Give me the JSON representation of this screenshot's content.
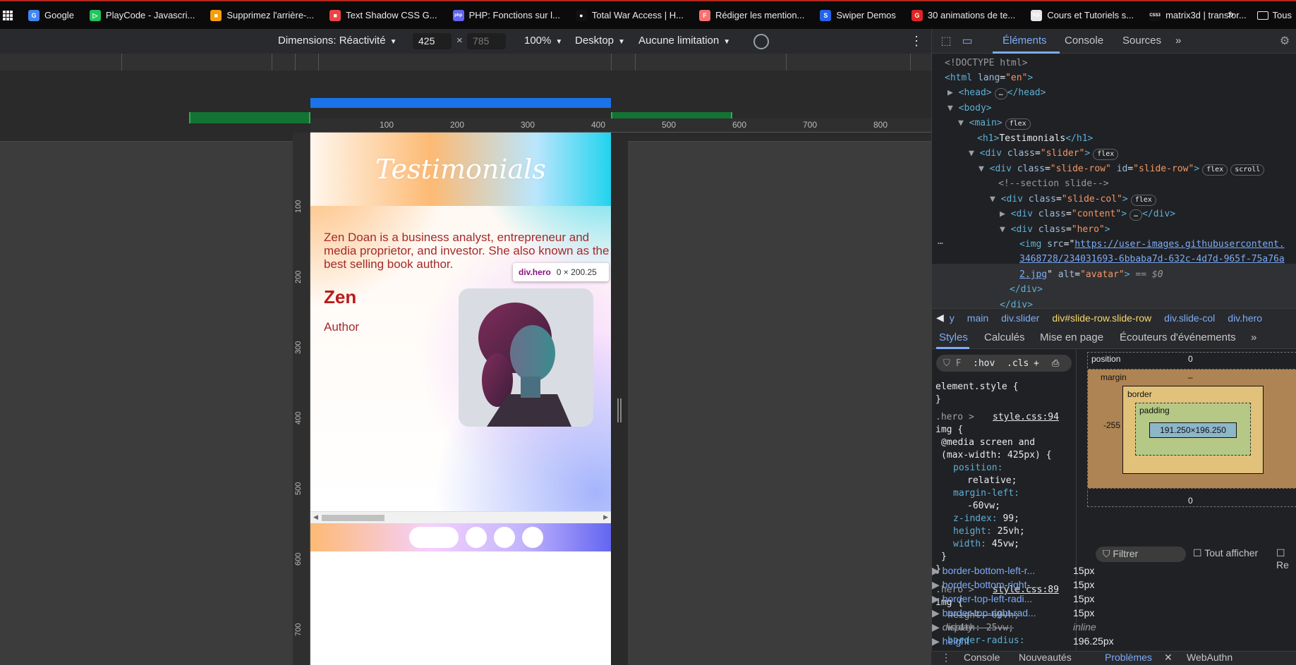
{
  "bookmarks": [
    {
      "label": "Google",
      "color": "#4285f4",
      "glyph": "G"
    },
    {
      "label": "PlayCode - Javascri...",
      "color": "#22c55e",
      "glyph": "▷"
    },
    {
      "label": "Supprimez l'arrière-...",
      "color": "#f59e0b",
      "glyph": "■"
    },
    {
      "label": "Text Shadow CSS G...",
      "color": "#ef4444",
      "glyph": "■"
    },
    {
      "label": "PHP: Fonctions sur l...",
      "color": "#6366f1",
      "glyph": "php"
    },
    {
      "label": "Total War Access | H...",
      "color": "#111111",
      "glyph": "●"
    },
    {
      "label": "Rédiger les mention...",
      "color": "#f87171",
      "glyph": "F"
    },
    {
      "label": "Swiper Demos",
      "color": "#2563eb",
      "glyph": "S"
    },
    {
      "label": "30 animations de te...",
      "color": "#dc2626",
      "glyph": "G"
    },
    {
      "label": "Cours et Tutoriels s...",
      "color": "#e5e7eb",
      "glyph": "SQL"
    },
    {
      "label": "matrix3d | transfor...",
      "color": "#111111",
      "glyph": "CSS3"
    }
  ],
  "bookmarks_more": "»",
  "other_bookmarks": "Tous",
  "device_toolbar": {
    "dimensions_label": "Dimensions: Réactivité",
    "width": "425",
    "height": "785",
    "zoom": "100%",
    "device_type": "Desktop",
    "throttle": "Aucune limitation"
  },
  "ruler_top": [
    "100",
    "200",
    "300",
    "400",
    "500",
    "600",
    "700",
    "800"
  ],
  "ruler_left": [
    "100",
    "200",
    "300",
    "400",
    "500",
    "600",
    "700"
  ],
  "page": {
    "title": "Testimonials",
    "bio": "Zen Doan is a business analyst, entrepreneur and media proprietor, and investor. She also known as the best selling book author.",
    "name": "Zen",
    "role": "Author"
  },
  "tooltip": {
    "selector": "div.hero",
    "size": "0 × 200.25"
  },
  "devtools": {
    "tabs": [
      "Éléments",
      "Console",
      "Sources"
    ],
    "more": "»",
    "tree": {
      "doctype": "<!DOCTYPE html>",
      "html_tag": "html",
      "lang_attr": "lang",
      "lang_val": "\"en\"",
      "head": "head",
      "body": "body",
      "main": "main",
      "h1_text": "Testimonials",
      "slider_class": "\"slider\"",
      "slide_row_class": "\"slide-row\"",
      "slide_row_id": "\"slide-row\"",
      "comment": "<!--section slide-->",
      "slide_col_class": "\"slide-col\"",
      "content_class": "\"content\"",
      "hero_class": "\"hero\"",
      "img_src_1": "https://user-images.githubusercontent.",
      "img_src_2": "3468728/234031693-6bbaba7d-632c-4d7d-965f-75a76a",
      "img_src_3": "2.jpg",
      "img_alt": "\"avatar\"",
      "dollar": "== $0",
      "pill_flex": "flex",
      "pill_scroll": "scroll"
    },
    "crumbs": [
      "y",
      "main",
      "div.slider",
      "div#slide-row.slide-row",
      "div.slide-col",
      "div.hero"
    ],
    "subtabs": [
      "Styles",
      "Calculés",
      "Mise en page",
      "Écouteurs d'événements"
    ],
    "filter_placeholder": "F",
    "hov": ":hov",
    "cls": ".cls",
    "styles": {
      "element_style": "element.style {",
      "close": "}",
      "rule1_selector": ".hero >",
      "rule1_source": "style.css:94",
      "rule1_img": "img {",
      "media": "@media screen and",
      "media2": "(max-width: 425px) {",
      "p1": "position:",
      "v1": "relative;",
      "p2": "margin-left:",
      "v2": "-60vw;",
      "p3": "z-index:",
      "v3": "99;",
      "p4": "height:",
      "v4": "25vh;",
      "p5": "width:",
      "v5": "45vw;",
      "rule2_selector": ".hero >",
      "rule2_source": "style.css:89",
      "rule2_img": "img {",
      "s1": "height: 60vh;",
      "s2": "width: 25vw;",
      "s3": "border-radius:"
    },
    "boxmodel": {
      "position_label": "position",
      "position_top": "0",
      "position_bottom": "0",
      "margin_label": "margin",
      "margin_left": "-255",
      "margin_dash": "–",
      "border_label": "border",
      "padding_label": "padding",
      "content": "191.250×196.250",
      "left_outer": "0"
    },
    "computed_filter": "Filtrer",
    "show_all": "Tout afficher",
    "regroup": "Re",
    "computed": [
      {
        "name": "border-bottom-left-r...",
        "value": "15px"
      },
      {
        "name": "border-bottom-right-...",
        "value": "15px"
      },
      {
        "name": "border-top-left-radi...",
        "value": "15px"
      },
      {
        "name": "border-top-right-rad...",
        "value": "15px"
      },
      {
        "name": "display",
        "value": "inline"
      },
      {
        "name": "height",
        "value": "196.25px"
      }
    ],
    "drawer": [
      "Console",
      "Nouveautés",
      "Problèmes",
      "WebAuthn"
    ]
  }
}
